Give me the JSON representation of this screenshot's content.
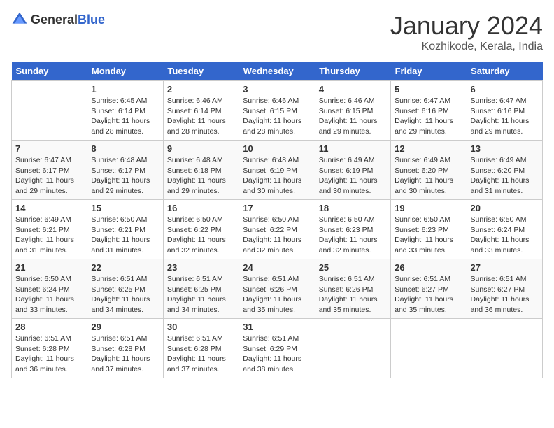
{
  "header": {
    "logo_general": "General",
    "logo_blue": "Blue",
    "title": "January 2024",
    "location": "Kozhikode, Kerala, India"
  },
  "days_of_week": [
    "Sunday",
    "Monday",
    "Tuesday",
    "Wednesday",
    "Thursday",
    "Friday",
    "Saturday"
  ],
  "weeks": [
    {
      "cells": [
        {
          "day": "",
          "empty": true
        },
        {
          "day": "1",
          "sunrise": "Sunrise: 6:45 AM",
          "sunset": "Sunset: 6:14 PM",
          "daylight": "Daylight: 11 hours and 28 minutes."
        },
        {
          "day": "2",
          "sunrise": "Sunrise: 6:46 AM",
          "sunset": "Sunset: 6:14 PM",
          "daylight": "Daylight: 11 hours and 28 minutes."
        },
        {
          "day": "3",
          "sunrise": "Sunrise: 6:46 AM",
          "sunset": "Sunset: 6:15 PM",
          "daylight": "Daylight: 11 hours and 28 minutes."
        },
        {
          "day": "4",
          "sunrise": "Sunrise: 6:46 AM",
          "sunset": "Sunset: 6:15 PM",
          "daylight": "Daylight: 11 hours and 29 minutes."
        },
        {
          "day": "5",
          "sunrise": "Sunrise: 6:47 AM",
          "sunset": "Sunset: 6:16 PM",
          "daylight": "Daylight: 11 hours and 29 minutes."
        },
        {
          "day": "6",
          "sunrise": "Sunrise: 6:47 AM",
          "sunset": "Sunset: 6:16 PM",
          "daylight": "Daylight: 11 hours and 29 minutes."
        }
      ]
    },
    {
      "cells": [
        {
          "day": "7",
          "sunrise": "Sunrise: 6:47 AM",
          "sunset": "Sunset: 6:17 PM",
          "daylight": "Daylight: 11 hours and 29 minutes."
        },
        {
          "day": "8",
          "sunrise": "Sunrise: 6:48 AM",
          "sunset": "Sunset: 6:17 PM",
          "daylight": "Daylight: 11 hours and 29 minutes."
        },
        {
          "day": "9",
          "sunrise": "Sunrise: 6:48 AM",
          "sunset": "Sunset: 6:18 PM",
          "daylight": "Daylight: 11 hours and 29 minutes."
        },
        {
          "day": "10",
          "sunrise": "Sunrise: 6:48 AM",
          "sunset": "Sunset: 6:19 PM",
          "daylight": "Daylight: 11 hours and 30 minutes."
        },
        {
          "day": "11",
          "sunrise": "Sunrise: 6:49 AM",
          "sunset": "Sunset: 6:19 PM",
          "daylight": "Daylight: 11 hours and 30 minutes."
        },
        {
          "day": "12",
          "sunrise": "Sunrise: 6:49 AM",
          "sunset": "Sunset: 6:20 PM",
          "daylight": "Daylight: 11 hours and 30 minutes."
        },
        {
          "day": "13",
          "sunrise": "Sunrise: 6:49 AM",
          "sunset": "Sunset: 6:20 PM",
          "daylight": "Daylight: 11 hours and 31 minutes."
        }
      ]
    },
    {
      "cells": [
        {
          "day": "14",
          "sunrise": "Sunrise: 6:49 AM",
          "sunset": "Sunset: 6:21 PM",
          "daylight": "Daylight: 11 hours and 31 minutes."
        },
        {
          "day": "15",
          "sunrise": "Sunrise: 6:50 AM",
          "sunset": "Sunset: 6:21 PM",
          "daylight": "Daylight: 11 hours and 31 minutes."
        },
        {
          "day": "16",
          "sunrise": "Sunrise: 6:50 AM",
          "sunset": "Sunset: 6:22 PM",
          "daylight": "Daylight: 11 hours and 32 minutes."
        },
        {
          "day": "17",
          "sunrise": "Sunrise: 6:50 AM",
          "sunset": "Sunset: 6:22 PM",
          "daylight": "Daylight: 11 hours and 32 minutes."
        },
        {
          "day": "18",
          "sunrise": "Sunrise: 6:50 AM",
          "sunset": "Sunset: 6:23 PM",
          "daylight": "Daylight: 11 hours and 32 minutes."
        },
        {
          "day": "19",
          "sunrise": "Sunrise: 6:50 AM",
          "sunset": "Sunset: 6:23 PM",
          "daylight": "Daylight: 11 hours and 33 minutes."
        },
        {
          "day": "20",
          "sunrise": "Sunrise: 6:50 AM",
          "sunset": "Sunset: 6:24 PM",
          "daylight": "Daylight: 11 hours and 33 minutes."
        }
      ]
    },
    {
      "cells": [
        {
          "day": "21",
          "sunrise": "Sunrise: 6:50 AM",
          "sunset": "Sunset: 6:24 PM",
          "daylight": "Daylight: 11 hours and 33 minutes."
        },
        {
          "day": "22",
          "sunrise": "Sunrise: 6:51 AM",
          "sunset": "Sunset: 6:25 PM",
          "daylight": "Daylight: 11 hours and 34 minutes."
        },
        {
          "day": "23",
          "sunrise": "Sunrise: 6:51 AM",
          "sunset": "Sunset: 6:25 PM",
          "daylight": "Daylight: 11 hours and 34 minutes."
        },
        {
          "day": "24",
          "sunrise": "Sunrise: 6:51 AM",
          "sunset": "Sunset: 6:26 PM",
          "daylight": "Daylight: 11 hours and 35 minutes."
        },
        {
          "day": "25",
          "sunrise": "Sunrise: 6:51 AM",
          "sunset": "Sunset: 6:26 PM",
          "daylight": "Daylight: 11 hours and 35 minutes."
        },
        {
          "day": "26",
          "sunrise": "Sunrise: 6:51 AM",
          "sunset": "Sunset: 6:27 PM",
          "daylight": "Daylight: 11 hours and 35 minutes."
        },
        {
          "day": "27",
          "sunrise": "Sunrise: 6:51 AM",
          "sunset": "Sunset: 6:27 PM",
          "daylight": "Daylight: 11 hours and 36 minutes."
        }
      ]
    },
    {
      "cells": [
        {
          "day": "28",
          "sunrise": "Sunrise: 6:51 AM",
          "sunset": "Sunset: 6:28 PM",
          "daylight": "Daylight: 11 hours and 36 minutes."
        },
        {
          "day": "29",
          "sunrise": "Sunrise: 6:51 AM",
          "sunset": "Sunset: 6:28 PM",
          "daylight": "Daylight: 11 hours and 37 minutes."
        },
        {
          "day": "30",
          "sunrise": "Sunrise: 6:51 AM",
          "sunset": "Sunset: 6:28 PM",
          "daylight": "Daylight: 11 hours and 37 minutes."
        },
        {
          "day": "31",
          "sunrise": "Sunrise: 6:51 AM",
          "sunset": "Sunset: 6:29 PM",
          "daylight": "Daylight: 11 hours and 38 minutes."
        },
        {
          "day": "",
          "empty": true
        },
        {
          "day": "",
          "empty": true
        },
        {
          "day": "",
          "empty": true
        }
      ]
    }
  ]
}
